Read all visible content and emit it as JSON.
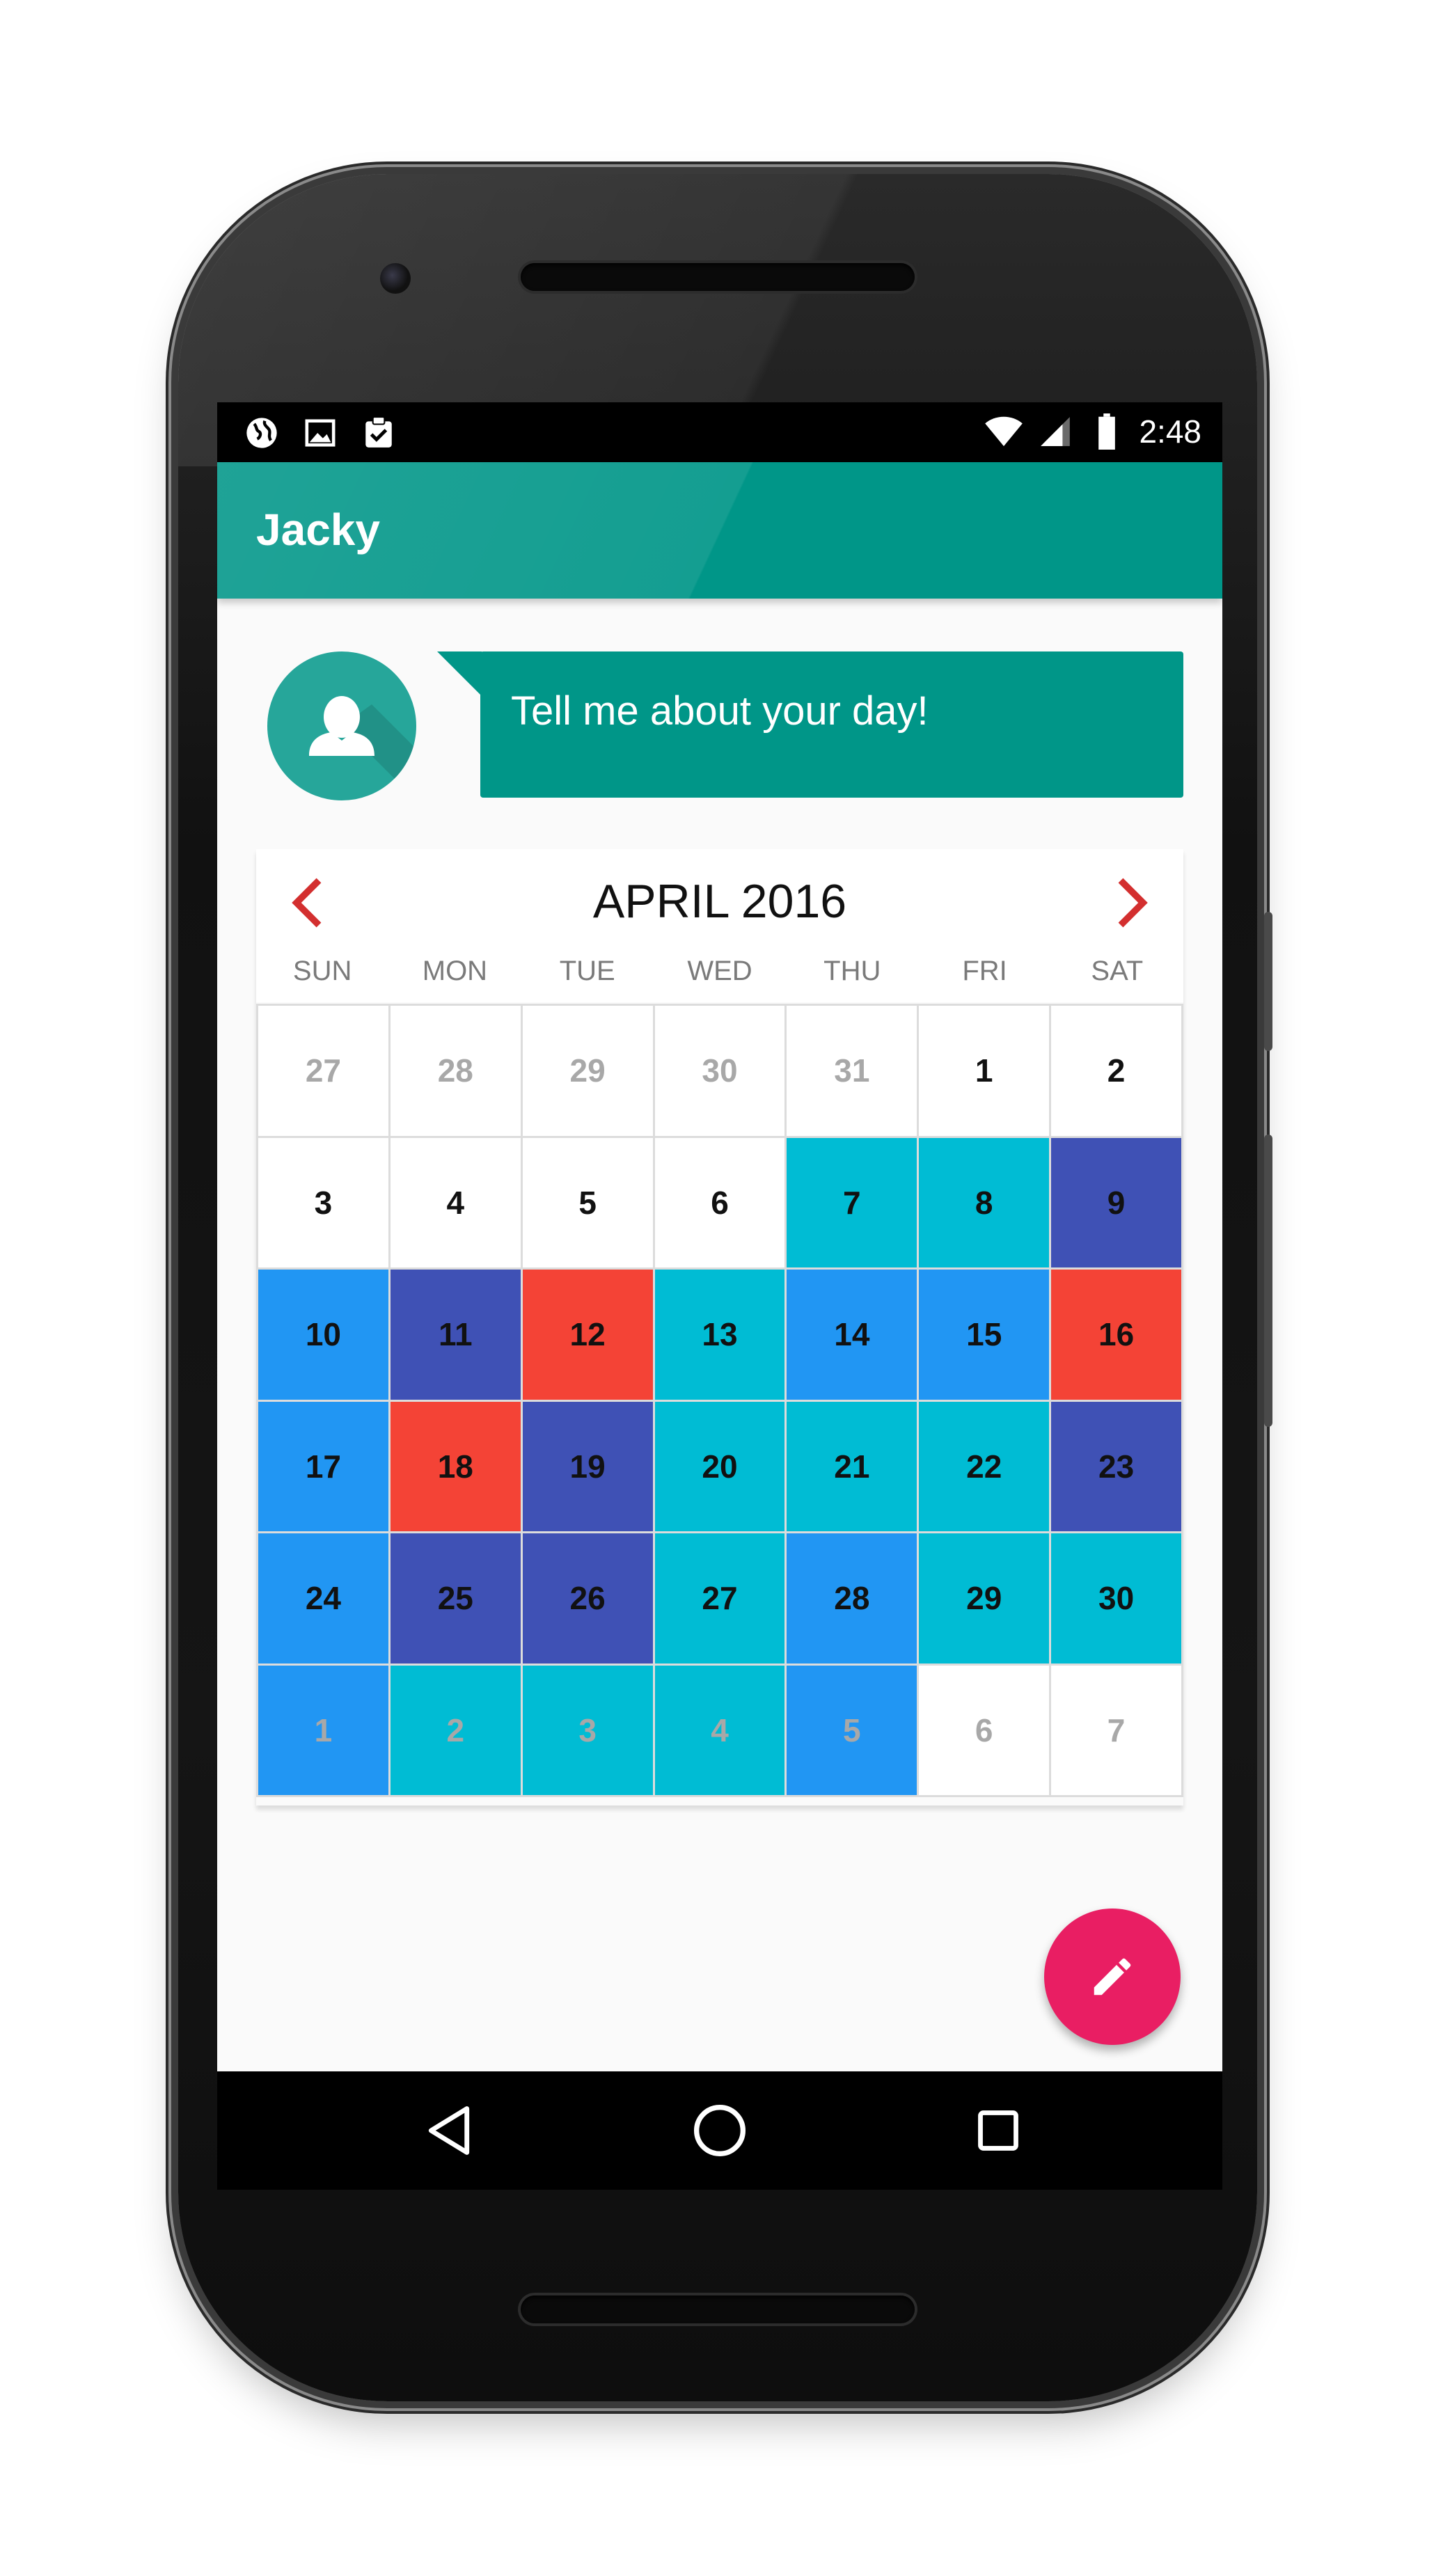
{
  "status_bar": {
    "time": "2:48",
    "left_icons": [
      "globe-icon",
      "image-icon",
      "clipboard-check-icon"
    ],
    "right_icons": [
      "wifi-icon",
      "signal-icon",
      "battery-icon"
    ]
  },
  "app_bar": {
    "title": "Jacky"
  },
  "chat": {
    "message": "Tell me about your day!"
  },
  "calendar": {
    "month_label": "APRIL 2016",
    "weekdays": [
      "SUN",
      "MON",
      "TUE",
      "WED",
      "THU",
      "FRI",
      "SAT"
    ],
    "weeks": [
      [
        {
          "label": "27",
          "outside": true,
          "color": "#ffffff"
        },
        {
          "label": "28",
          "outside": true,
          "color": "#ffffff"
        },
        {
          "label": "29",
          "outside": true,
          "color": "#ffffff"
        },
        {
          "label": "30",
          "outside": true,
          "color": "#ffffff"
        },
        {
          "label": "31",
          "outside": true,
          "color": "#ffffff"
        },
        {
          "label": "1",
          "outside": false,
          "color": "#ffffff"
        },
        {
          "label": "2",
          "outside": false,
          "color": "#ffffff"
        }
      ],
      [
        {
          "label": "3",
          "outside": false,
          "color": "#ffffff"
        },
        {
          "label": "4",
          "outside": false,
          "color": "#ffffff"
        },
        {
          "label": "5",
          "outside": false,
          "color": "#ffffff"
        },
        {
          "label": "6",
          "outside": false,
          "color": "#ffffff"
        },
        {
          "label": "7",
          "outside": false,
          "color": "#00bcd4"
        },
        {
          "label": "8",
          "outside": false,
          "color": "#00bcd4"
        },
        {
          "label": "9",
          "outside": false,
          "color": "#3f51b5"
        }
      ],
      [
        {
          "label": "10",
          "outside": false,
          "color": "#2196f3"
        },
        {
          "label": "11",
          "outside": false,
          "color": "#3f51b5"
        },
        {
          "label": "12",
          "outside": false,
          "color": "#f44336"
        },
        {
          "label": "13",
          "outside": false,
          "color": "#00bcd4"
        },
        {
          "label": "14",
          "outside": false,
          "color": "#2196f3"
        },
        {
          "label": "15",
          "outside": false,
          "color": "#2196f3"
        },
        {
          "label": "16",
          "outside": false,
          "color": "#f44336"
        }
      ],
      [
        {
          "label": "17",
          "outside": false,
          "color": "#2196f3"
        },
        {
          "label": "18",
          "outside": false,
          "color": "#f44336"
        },
        {
          "label": "19",
          "outside": false,
          "color": "#3f51b5"
        },
        {
          "label": "20",
          "outside": false,
          "color": "#00bcd4"
        },
        {
          "label": "21",
          "outside": false,
          "color": "#00bcd4"
        },
        {
          "label": "22",
          "outside": false,
          "color": "#00bcd4"
        },
        {
          "label": "23",
          "outside": false,
          "color": "#3f51b5"
        }
      ],
      [
        {
          "label": "24",
          "outside": false,
          "color": "#2196f3"
        },
        {
          "label": "25",
          "outside": false,
          "color": "#3f51b5"
        },
        {
          "label": "26",
          "outside": false,
          "color": "#3f51b5"
        },
        {
          "label": "27",
          "outside": false,
          "color": "#00bcd4"
        },
        {
          "label": "28",
          "outside": false,
          "color": "#2196f3"
        },
        {
          "label": "29",
          "outside": false,
          "color": "#00bcd4"
        },
        {
          "label": "30",
          "outside": false,
          "color": "#00bcd4"
        }
      ],
      [
        {
          "label": "1",
          "outside": true,
          "color": "#2196f3"
        },
        {
          "label": "2",
          "outside": true,
          "color": "#00bcd4"
        },
        {
          "label": "3",
          "outside": true,
          "color": "#00bcd4"
        },
        {
          "label": "4",
          "outside": true,
          "color": "#00bcd4"
        },
        {
          "label": "5",
          "outside": true,
          "color": "#2196f3"
        },
        {
          "label": "6",
          "outside": true,
          "color": "#ffffff"
        },
        {
          "label": "7",
          "outside": true,
          "color": "#ffffff"
        }
      ]
    ]
  },
  "fab": {
    "icon": "pencil-icon"
  },
  "nav_bar": {
    "icons": [
      "back-icon",
      "home-icon",
      "recents-icon"
    ]
  },
  "colors": {
    "primary": "#009688",
    "accent": "#e91e63",
    "nav_arrow": "#d32f2f",
    "cyan": "#00bcd4",
    "blue": "#2196f3",
    "indigo": "#3f51b5",
    "red": "#f44336"
  }
}
